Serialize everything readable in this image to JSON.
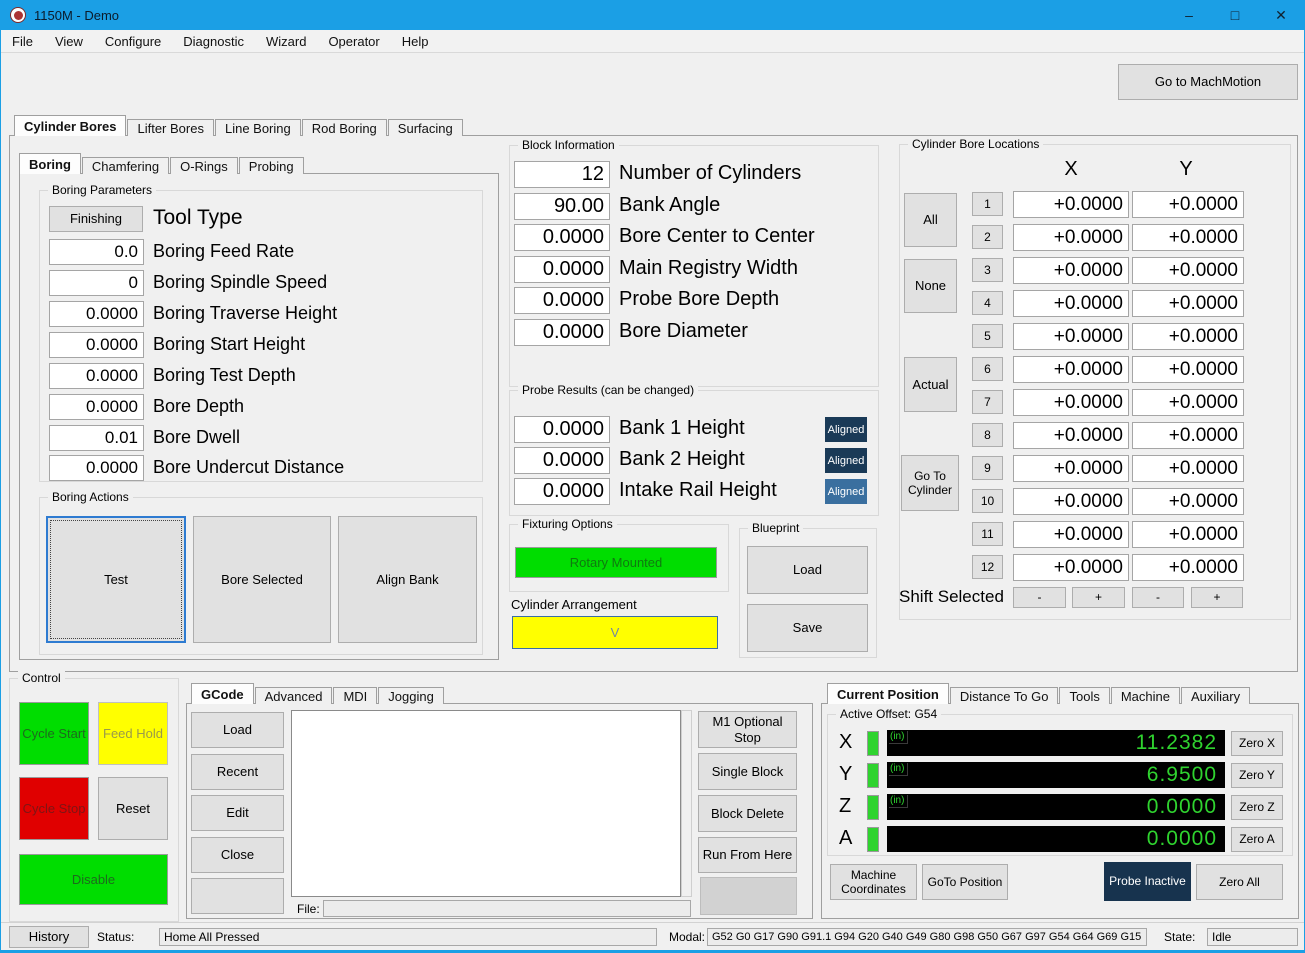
{
  "window": {
    "title": "1150M - Demo",
    "minimize_icon": "–",
    "maximize_icon": "□",
    "close_icon": "✕"
  },
  "menu": {
    "items": [
      "File",
      "View",
      "Configure",
      "Diagnostic",
      "Wizard",
      "Operator",
      "Help"
    ]
  },
  "header": {
    "go_to_machmotion": "Go to MachMotion"
  },
  "main_tabs": {
    "items": [
      "Cylinder Bores",
      "Lifter Bores",
      "Line Boring",
      "Rod Boring",
      "Surfacing"
    ],
    "active": "Cylinder Bores"
  },
  "sub_tabs": {
    "items": [
      "Boring",
      "Chamfering",
      "O-Rings",
      "Probing"
    ],
    "active": "Boring"
  },
  "boring_parameters": {
    "title": "Boring Parameters",
    "tool_type": {
      "button": "Finishing",
      "label": "Tool Type"
    },
    "rows": [
      {
        "value": "0.0",
        "label": "Boring Feed Rate"
      },
      {
        "value": "0",
        "label": "Boring Spindle Speed"
      },
      {
        "value": "0.0000",
        "label": "Boring Traverse Height"
      },
      {
        "value": "0.0000",
        "label": "Boring Start Height"
      },
      {
        "value": "0.0000",
        "label": "Boring Test Depth"
      },
      {
        "value": "0.0000",
        "label": "Bore Depth"
      },
      {
        "value": "0.01",
        "label": "Bore Dwell"
      },
      {
        "value": "0.0000",
        "label": "Bore Undercut Distance"
      }
    ]
  },
  "boring_actions": {
    "title": "Boring Actions",
    "test": "Test",
    "bore_selected": "Bore Selected",
    "align_bank": "Align Bank"
  },
  "block_information": {
    "title": "Block Information",
    "rows": [
      {
        "value": "12",
        "label": "Number of Cylinders"
      },
      {
        "value": "90.00",
        "label": "Bank Angle"
      },
      {
        "value": "0.0000",
        "label": "Bore Center to Center"
      },
      {
        "value": "0.0000",
        "label": "Main Registry Width"
      },
      {
        "value": "0.0000",
        "label": "Probe Bore Depth"
      },
      {
        "value": "0.0000",
        "label": "Bore Diameter"
      }
    ]
  },
  "probe_results": {
    "title": "Probe Results (can be changed)",
    "rows": [
      {
        "value": "0.0000",
        "label": "Bank 1 Height",
        "badge": "Aligned"
      },
      {
        "value": "0.0000",
        "label": "Bank 2 Height",
        "badge": "Aligned"
      },
      {
        "value": "0.0000",
        "label": "Intake Rail Height",
        "badge": "Aligned"
      }
    ]
  },
  "fixturing": {
    "title": "Fixturing Options",
    "button": "Rotary Mounted"
  },
  "cylinder_arrangement": {
    "label": "Cylinder Arrangement",
    "value": "V"
  },
  "blueprint": {
    "title": "Blueprint",
    "load": "Load",
    "save": "Save"
  },
  "bore_locations": {
    "title": "Cylinder Bore Locations",
    "col_x": "X",
    "col_y": "Y",
    "all": "All",
    "none": "None",
    "actual": "Actual",
    "go_to_cylinder": "Go To Cylinder",
    "shift_selected": "Shift Selected",
    "minus": "-",
    "plus": "+",
    "rows": [
      {
        "num": "1",
        "x": "+0.0000",
        "y": "+0.0000"
      },
      {
        "num": "2",
        "x": "+0.0000",
        "y": "+0.0000"
      },
      {
        "num": "3",
        "x": "+0.0000",
        "y": "+0.0000"
      },
      {
        "num": "4",
        "x": "+0.0000",
        "y": "+0.0000"
      },
      {
        "num": "5",
        "x": "+0.0000",
        "y": "+0.0000"
      },
      {
        "num": "6",
        "x": "+0.0000",
        "y": "+0.0000"
      },
      {
        "num": "7",
        "x": "+0.0000",
        "y": "+0.0000"
      },
      {
        "num": "8",
        "x": "+0.0000",
        "y": "+0.0000"
      },
      {
        "num": "9",
        "x": "+0.0000",
        "y": "+0.0000"
      },
      {
        "num": "10",
        "x": "+0.0000",
        "y": "+0.0000"
      },
      {
        "num": "11",
        "x": "+0.0000",
        "y": "+0.0000"
      },
      {
        "num": "12",
        "x": "+0.0000",
        "y": "+0.0000"
      }
    ]
  },
  "control": {
    "title": "Control",
    "cycle_start": "Cycle Start",
    "feed_hold": "Feed Hold",
    "cycle_stop": "Cycle Stop",
    "reset": "Reset",
    "disable": "Disable"
  },
  "gcode": {
    "tabs": [
      "GCode",
      "Advanced",
      "MDI",
      "Jogging"
    ],
    "active": "GCode",
    "load": "Load",
    "recent": "Recent",
    "edit": "Edit",
    "close": "Close",
    "file_label": "File:",
    "file_value": "",
    "m1_optional_stop": "M1 Optional Stop",
    "single_block": "Single Block",
    "block_delete": "Block Delete",
    "run_from_here": "Run From Here"
  },
  "position": {
    "tabs": [
      "Current Position",
      "Distance To Go",
      "Tools",
      "Machine",
      "Auxiliary"
    ],
    "active": "Current Position",
    "active_offset": "Active Offset: G54",
    "axes": [
      {
        "axis": "X",
        "unit": "(in)",
        "value": "11.2382",
        "zero": "Zero X"
      },
      {
        "axis": "Y",
        "unit": "(in)",
        "value": "6.9500",
        "zero": "Zero Y"
      },
      {
        "axis": "Z",
        "unit": "(in)",
        "value": "0.0000",
        "zero": "Zero Z"
      },
      {
        "axis": "A",
        "unit": "",
        "value": "0.0000",
        "zero": "Zero A"
      }
    ],
    "machine_coordinates": "Machine Coordinates",
    "goto_position": "GoTo Position",
    "probe_status": "Probe Inactive",
    "zero_all": "Zero All"
  },
  "status_bar": {
    "history": "History",
    "status_label": "Status:",
    "status_value": "Home All Pressed",
    "modal_label": "Modal:",
    "modal_value": "G52 G0 G17 G90 G91.1 G94 G20 G40 G49 G80 G98 G50 G67 G97 G54 G64 G69 G15",
    "state_label": "State:",
    "state_value": "Idle"
  },
  "colors": {
    "titlebar": "#1b9fe5",
    "green": "#00dd00",
    "yellow": "#ffff00",
    "red": "#e00000",
    "badge_navy": "#1a3a57",
    "badge_blue": "#3a6f9f",
    "probe_navy": "#17334e",
    "lcd_green": "#2fd32f"
  }
}
